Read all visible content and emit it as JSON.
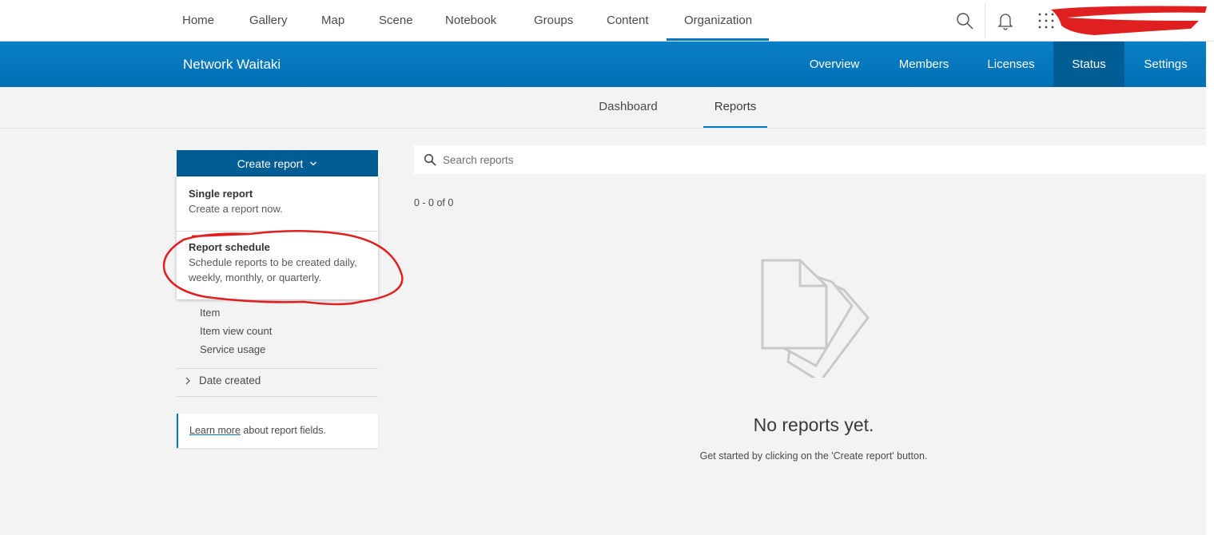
{
  "topnav": {
    "items": [
      "Home",
      "Gallery",
      "Map",
      "Scene",
      "Notebook",
      "Groups",
      "Content",
      "Organization"
    ],
    "active": "Organization",
    "icons": [
      "search-icon",
      "bell-icon",
      "apps-grid-icon"
    ]
  },
  "org": {
    "title": "Network Waitaki",
    "tabs": [
      "Overview",
      "Members",
      "Licenses",
      "Status",
      "Settings"
    ],
    "active_tab": "Status"
  },
  "subtabs": {
    "items": [
      "Dashboard",
      "Reports"
    ],
    "active": "Reports"
  },
  "create_report": {
    "label": "Create report",
    "menu": [
      {
        "title": "Single report",
        "desc": "Create a report now."
      },
      {
        "title": "Report schedule",
        "desc_line1": "Schedule reports to be created daily,",
        "desc_line2": "weekly, monthly, or quarterly."
      }
    ]
  },
  "filters": {
    "items": [
      "Item",
      "Item view count",
      "Service usage"
    ],
    "date_created": "Date created"
  },
  "learn": {
    "link": "Learn more",
    "text": " about report fields."
  },
  "search": {
    "placeholder": "Search reports"
  },
  "results": {
    "count": "0 - 0 of 0",
    "empty_title": "No reports yet.",
    "empty_subtitle": "Get started by clicking on the 'Create report' button."
  },
  "colors": {
    "brand_blue": "#0079c1",
    "dark_blue": "#005e95",
    "annotation_red": "#e02020"
  }
}
